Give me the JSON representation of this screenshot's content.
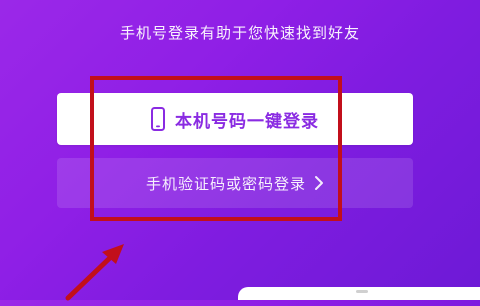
{
  "header": {
    "subtitle": "手机号登录有助于您快速找到好友"
  },
  "actions": {
    "one_click_login_label": "本机号码一键登录",
    "sms_or_password_login_label": "手机验证码或密码登录"
  },
  "icons": {
    "phone": "phone-icon",
    "chevron": "chevron-right-icon"
  },
  "colors": {
    "background_start": "#9b28e8",
    "background_end": "#6d1ad6",
    "primary_button_bg": "#ffffff",
    "primary_button_text": "#8a2be2",
    "highlight_red": "#c20f1b"
  }
}
